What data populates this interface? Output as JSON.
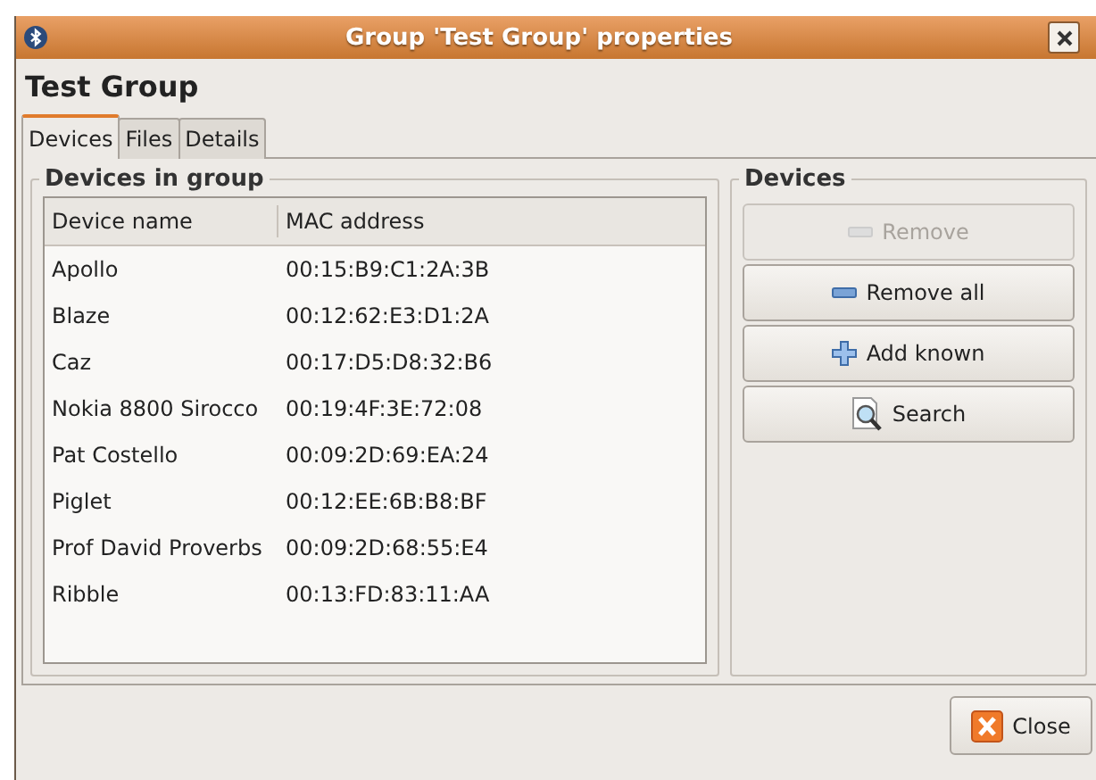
{
  "window": {
    "title": "Group 'Test Group' properties"
  },
  "heading": "Test Group",
  "tabs": [
    {
      "label": "Devices",
      "selected": true
    },
    {
      "label": "Files",
      "selected": false
    },
    {
      "label": "Details",
      "selected": false
    }
  ],
  "devices_in_group": {
    "title": "Devices in group",
    "columns": [
      "Device name",
      "MAC address"
    ],
    "rows": [
      {
        "name": "Apollo",
        "mac": "00:15:B9:C1:2A:3B"
      },
      {
        "name": "Blaze",
        "mac": "00:12:62:E3:D1:2A"
      },
      {
        "name": "Caz",
        "mac": "00:17:D5:D8:32:B6"
      },
      {
        "name": "Nokia 8800 Sirocco",
        "mac": "00:19:4F:3E:72:08"
      },
      {
        "name": "Pat Costello",
        "mac": "00:09:2D:69:EA:24"
      },
      {
        "name": "Piglet",
        "mac": "00:12:EE:6B:B8:BF"
      },
      {
        "name": "Prof David Proverbs",
        "mac": "00:09:2D:68:55:E4"
      },
      {
        "name": "Ribble",
        "mac": "00:13:FD:83:11:AA"
      }
    ]
  },
  "devices": {
    "title": "Devices",
    "buttons": [
      {
        "label": "Remove",
        "kind": "minus",
        "disabled": true
      },
      {
        "label": "Remove all",
        "kind": "minus",
        "disabled": false
      },
      {
        "label": "Add known",
        "kind": "plus",
        "disabled": false
      },
      {
        "label": "Search",
        "kind": "search",
        "disabled": false
      }
    ]
  },
  "close_button": {
    "label": "Close"
  }
}
